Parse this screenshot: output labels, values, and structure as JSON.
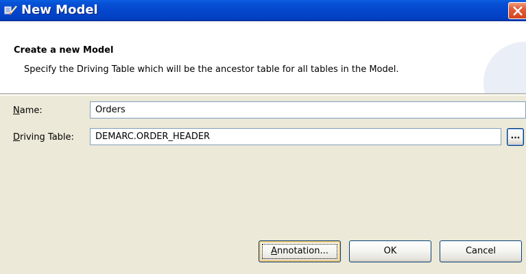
{
  "window": {
    "title": "New Model",
    "app_icon": "pencil-wizard-icon",
    "close_icon": "close-icon"
  },
  "banner": {
    "title": "Create a new Model",
    "description": "Specify the Driving Table which will be the ancestor table for all tables in the Model."
  },
  "form": {
    "name_label_mnemonic": "N",
    "name_label_rest": "ame:",
    "name_value": "Orders",
    "table_label_mnemonic": "D",
    "table_label_rest": "riving Table:",
    "table_value": "DEMARC.ORDER_HEADER",
    "browse_label": "..."
  },
  "buttons": {
    "annotation_mnemonic": "A",
    "annotation_rest": "nnotation...",
    "ok": "OK",
    "cancel": "Cancel"
  },
  "colors": {
    "titlebar": "#0446cc",
    "close": "#d4431c",
    "dialog_bg": "#ece9d8"
  }
}
